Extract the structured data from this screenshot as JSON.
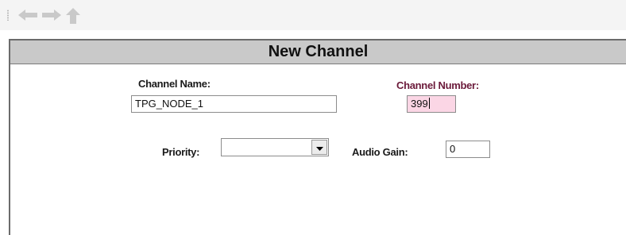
{
  "toolbar": {
    "icons": [
      "back-arrow-icon",
      "forward-arrow-icon",
      "up-arrow-icon"
    ]
  },
  "panel": {
    "title": "New Channel"
  },
  "form": {
    "channel_name_label": "Channel Name:",
    "channel_name_value": "TPG_NODE_1",
    "channel_number_label": "Channel Number:",
    "channel_number_value": "399",
    "priority_label": "Priority:",
    "priority_value": "",
    "audio_gain_label": "Audio Gain:",
    "audio_gain_value": "0"
  },
  "colors": {
    "highlight": "#f3a6c4",
    "header_bg": "#c9c9c9",
    "channel_number_label": "#6b1a3a"
  }
}
